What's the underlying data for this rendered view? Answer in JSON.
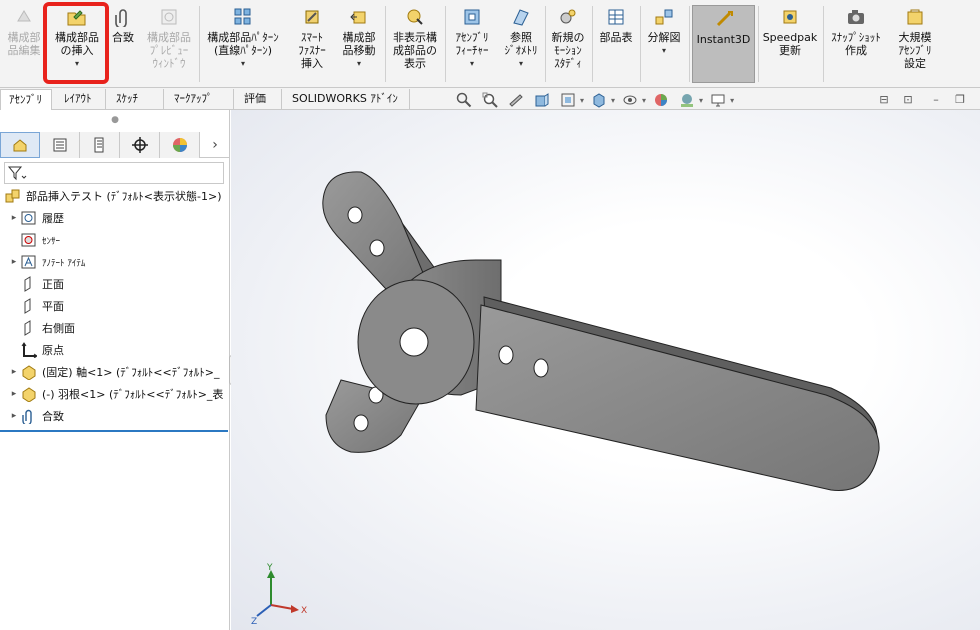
{
  "ribbon": {
    "buttons": [
      {
        "id": "edit_component",
        "label": "構成部\n品編集",
        "disabled": true
      },
      {
        "id": "insert_component",
        "label": "構成部品\nの挿入",
        "arrow": "▾"
      },
      {
        "id": "mate",
        "label": "合致"
      },
      {
        "id": "component_preview",
        "label": "構成部品\nﾌﾟﾚﾋﾞｭｰ\nｳｨﾝﾄﾞｳ",
        "disabled": true
      },
      {
        "id": "linear_pattern",
        "label": "構成部品ﾊﾟﾀｰﾝ\n(直線ﾊﾟﾀｰﾝ)",
        "arrow": "▾"
      },
      {
        "id": "smart_fasteners",
        "label": "ｽﾏｰﾄ\nﾌｧｽﾅｰ\n挿入"
      },
      {
        "id": "move_component",
        "label": "構成部\n品移動",
        "arrow": "▾"
      },
      {
        "id": "show_hidden",
        "label": "非表示構\n成部品の\n表示"
      },
      {
        "id": "assembly_features",
        "label": "ｱｾﾝﾌﾞﾘ\nﾌｨｰﾁｬｰ",
        "arrow": "▾"
      },
      {
        "id": "ref_geometry",
        "label": "参照\nｼﾞｵﾒﾄﾘ",
        "arrow": "▾"
      },
      {
        "id": "motion_study",
        "label": "新規の\nﾓｰｼｮﾝ\nｽﾀﾃﾞｨ"
      },
      {
        "id": "bom",
        "label": "部品表"
      },
      {
        "id": "exploded_view",
        "label": "分解図",
        "arrow": "▾"
      },
      {
        "id": "instant3d",
        "label": "Instant3D"
      },
      {
        "id": "speedpak",
        "label": "Speedpak\n更新"
      },
      {
        "id": "snapshot",
        "label": "ｽﾅｯﾌﾟｼｮｯﾄ\n作成"
      },
      {
        "id": "large_assembly",
        "label": "大規模\nｱｾﾝﾌﾞﾘ\n設定"
      }
    ]
  },
  "tabs": [
    "ｱｾﾝﾌﾞﾘ",
    "ﾚｲｱｳﾄ",
    "ｽｹｯﾁ",
    "ﾏｰｸｱｯﾌﾟ",
    "評価",
    "SOLIDWORKS ｱﾄﾞｲﾝ"
  ],
  "tree": {
    "root": "部品挿入テスト (ﾃﾞﾌｫﾙﾄ<表示状態-1>)",
    "items": [
      {
        "label": "履歴",
        "expand": "▸",
        "icon": "history-icon"
      },
      {
        "label": "ｾﾝｻｰ",
        "expand": "",
        "icon": "sensor-icon",
        "small": true
      },
      {
        "label": "ｱﾉﾃｰﾄ ｱｲﾃﾑ",
        "expand": "▸",
        "icon": "annotation-icon",
        "small": true
      },
      {
        "label": "正面",
        "expand": "",
        "icon": "plane-icon"
      },
      {
        "label": "平面",
        "expand": "",
        "icon": "plane-icon"
      },
      {
        "label": "右側面",
        "expand": "",
        "icon": "plane-icon"
      },
      {
        "label": "原点",
        "expand": "",
        "icon": "origin-icon"
      },
      {
        "label": "(固定) 軸<1> (ﾃﾞﾌｫﾙﾄ<<ﾃﾞﾌｫﾙﾄ>_",
        "expand": "▸",
        "icon": "part-icon"
      },
      {
        "label": "(-) 羽根<1> (ﾃﾞﾌｫﾙﾄ<<ﾃﾞﾌｫﾙﾄ>_表",
        "expand": "▸",
        "icon": "part-icon"
      },
      {
        "label": "合致",
        "expand": "▸",
        "icon": "mate-icon"
      }
    ]
  },
  "triad": {
    "x": "X",
    "y": "Y",
    "z": "Z"
  },
  "colors": {
    "highlight": "#e8221c",
    "active_tab": "#2b78c2"
  }
}
